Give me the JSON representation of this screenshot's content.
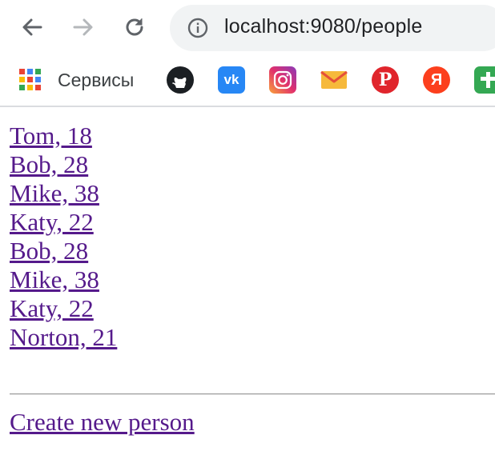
{
  "browser": {
    "url": "localhost:9080/people",
    "icons": {
      "back": "back-arrow-icon",
      "forward": "forward-arrow-icon",
      "reload": "reload-icon",
      "info": "info-icon"
    },
    "bookmarks": {
      "apps_label": "Сервисы",
      "vk_text": "vk",
      "pinterest_text": "P",
      "yandex_text": "Я",
      "items": [
        "github-icon",
        "vk-icon",
        "instagram-icon",
        "mail-icon",
        "pinterest-icon",
        "yandex-icon",
        "cross-icon"
      ]
    }
  },
  "page": {
    "people": [
      {
        "label": "Tom, 18"
      },
      {
        "label": "Bob, 28"
      },
      {
        "label": "Mike, 38"
      },
      {
        "label": "Katy, 22"
      },
      {
        "label": "Bob, 28"
      },
      {
        "label": "Mike, 38"
      },
      {
        "label": "Katy, 22"
      },
      {
        "label": "Norton, 21"
      }
    ],
    "create_link": "Create new person"
  },
  "colors": {
    "visited_link": "#551a8b",
    "omnibox_bg": "#f1f3f4",
    "chrome_icon": "#5f6368"
  }
}
